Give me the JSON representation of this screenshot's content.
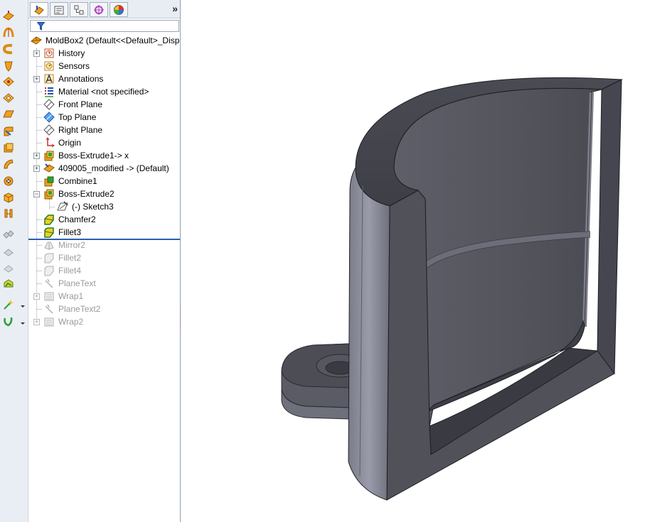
{
  "feature_manager": {
    "tabs": [
      "featuremanager-tab",
      "propertymanager-tab",
      "configurationmanager-tab",
      "dimxpert-tab",
      "display-manager-tab"
    ],
    "more_label": "»",
    "filter": {
      "value": ""
    },
    "root": {
      "label": "MoldBox2  (Default<<Default>_Disp"
    },
    "items": [
      {
        "label": "History",
        "icon": "history-icon"
      },
      {
        "label": "Sensors",
        "icon": "sensors-icon"
      },
      {
        "label": "Annotations",
        "icon": "annotations-icon"
      },
      {
        "label": "Material <not specified>",
        "icon": "material-icon"
      },
      {
        "label": "Front Plane",
        "icon": "plane-icon"
      },
      {
        "label": "Top Plane",
        "icon": "plane-icon"
      },
      {
        "label": "Right Plane",
        "icon": "plane-icon"
      },
      {
        "label": "Origin",
        "icon": "origin-icon"
      },
      {
        "label": "Boss-Extrude1-> x",
        "icon": "boss-extrude-icon"
      },
      {
        "label": "409005_modified -> (Default)",
        "icon": "derived-part-icon"
      },
      {
        "label": "Combine1",
        "icon": "combine-icon"
      },
      {
        "label": "Boss-Extrude2",
        "icon": "boss-extrude-icon"
      },
      {
        "label": "(-) Sketch3",
        "icon": "sketch-icon"
      },
      {
        "label": "Chamfer2",
        "icon": "chamfer-icon"
      },
      {
        "label": "Fillet3",
        "icon": "fillet-icon"
      },
      {
        "label": "Mirror2",
        "icon": "mirror-icon"
      },
      {
        "label": "Fillet2",
        "icon": "fillet-icon"
      },
      {
        "label": "Fillet4",
        "icon": "fillet-icon"
      },
      {
        "label": "PlaneText",
        "icon": "sketch-text-icon"
      },
      {
        "label": "Wrap1",
        "icon": "wrap-icon"
      },
      {
        "label": "PlaneText2",
        "icon": "sketch-text-icon"
      },
      {
        "label": "Wrap2",
        "icon": "wrap-icon"
      }
    ]
  },
  "colors": {
    "accent": "#2b5fb0",
    "model_face": "#55565e",
    "model_dark": "#3c3d44",
    "model_light": "#8a8c98",
    "toolbar_bg": "#e9eef5",
    "suppressed_text": "#9a9a9a"
  }
}
